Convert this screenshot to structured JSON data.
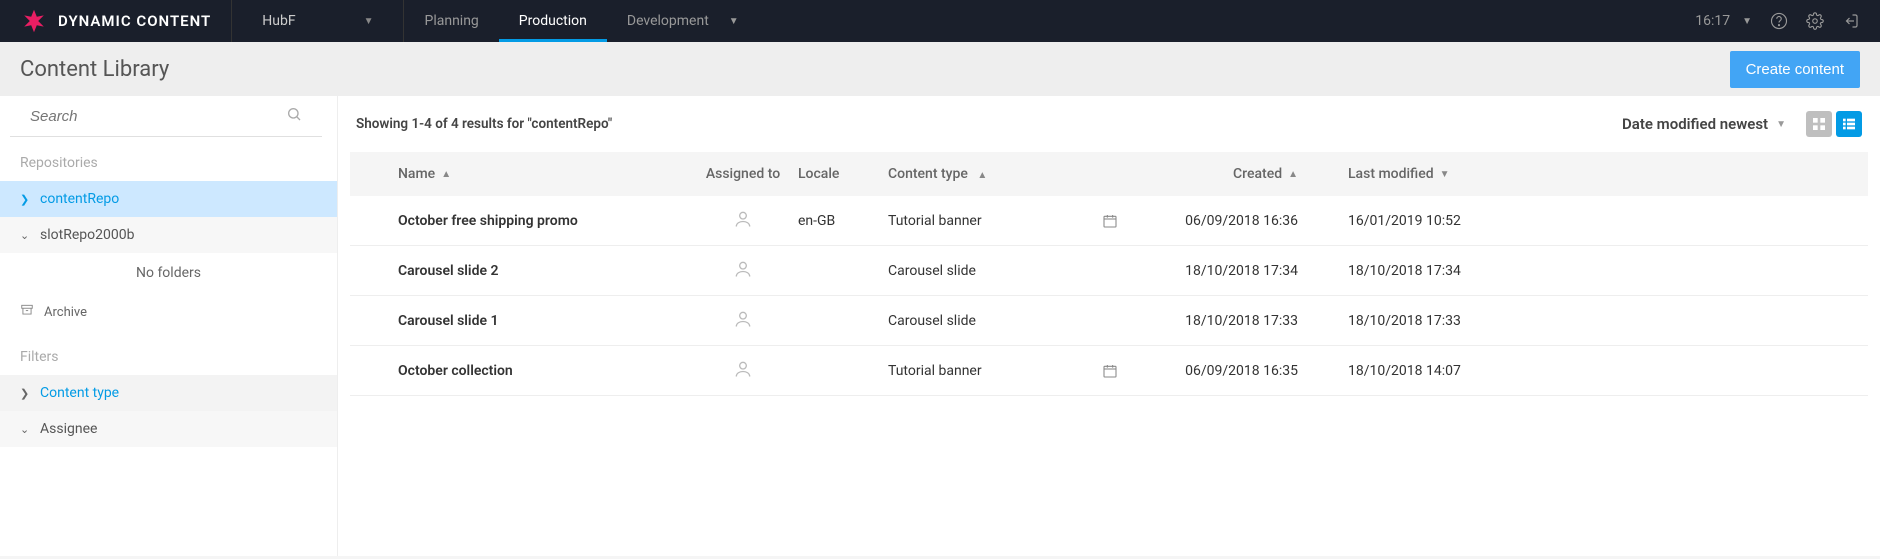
{
  "brand": "DYNAMIC CONTENT",
  "hub": {
    "name": "HubF"
  },
  "nav": {
    "planning": "Planning",
    "production": "Production",
    "development": "Development"
  },
  "clock": "16:17",
  "page_title": "Content Library",
  "create_button": "Create content",
  "search": {
    "placeholder": "Search"
  },
  "sidebar": {
    "repositories_label": "Repositories",
    "repos": [
      {
        "name": "contentRepo",
        "selected": true,
        "expanded": true
      },
      {
        "name": "slotRepo2000b",
        "selected": false,
        "expanded": false
      }
    ],
    "no_folders": "No folders",
    "archive": "Archive",
    "filters_label": "Filters",
    "filters": [
      {
        "name": "Content type",
        "selected": true
      },
      {
        "name": "Assignee",
        "selected": false
      }
    ]
  },
  "results_text": "Showing 1-4 of 4 results for \"contentRepo\"",
  "sort_label": "Date modified newest",
  "columns": {
    "name": "Name",
    "assigned": "Assigned to",
    "locale": "Locale",
    "type": "Content type",
    "created": "Created",
    "modified": "Last modified"
  },
  "rows": [
    {
      "name": "October free shipping promo",
      "locale": "en-GB",
      "type": "Tutorial banner",
      "scheduled": true,
      "created": "06/09/2018 16:36",
      "modified": "16/01/2019 10:52"
    },
    {
      "name": "Carousel slide 2",
      "locale": "",
      "type": "Carousel slide",
      "scheduled": false,
      "created": "18/10/2018 17:34",
      "modified": "18/10/2018 17:34"
    },
    {
      "name": "Carousel slide 1",
      "locale": "",
      "type": "Carousel slide",
      "scheduled": false,
      "created": "18/10/2018 17:33",
      "modified": "18/10/2018 17:33"
    },
    {
      "name": "October collection",
      "locale": "",
      "type": "Tutorial banner",
      "scheduled": true,
      "created": "06/09/2018 16:35",
      "modified": "18/10/2018 14:07"
    }
  ]
}
